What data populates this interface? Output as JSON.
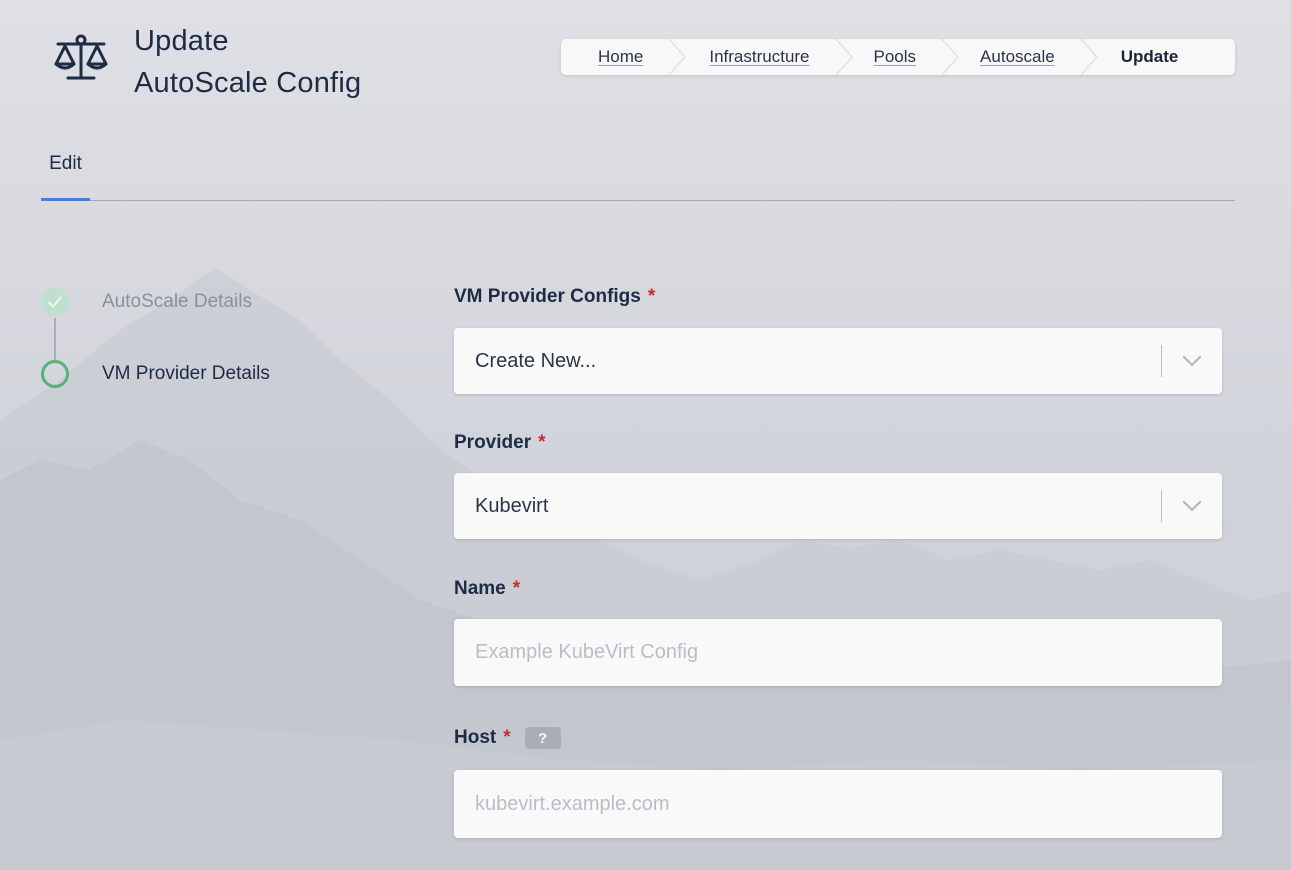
{
  "header": {
    "title_line1": "Update",
    "title_line2": "AutoScale Config",
    "icon": "scale-balance-icon"
  },
  "breadcrumb": [
    {
      "label": "Home"
    },
    {
      "label": "Infrastructure"
    },
    {
      "label": "Pools"
    },
    {
      "label": "Autoscale"
    },
    {
      "label": "Update"
    }
  ],
  "tabs": [
    {
      "label": "Edit",
      "active": true
    }
  ],
  "steps": [
    {
      "label": "AutoScale Details",
      "status": "completed",
      "icon": "check-icon"
    },
    {
      "label": "VM Provider Details",
      "status": "current"
    }
  ],
  "form": {
    "vm_provider_configs": {
      "label": "VM Provider Configs",
      "required_mark": "*",
      "value": "Create New..."
    },
    "provider": {
      "label": "Provider",
      "required_mark": "*",
      "value": "Kubevirt"
    },
    "name": {
      "label": "Name",
      "required_mark": "*",
      "value": "",
      "placeholder": "Example KubeVirt Config"
    },
    "host": {
      "label": "Host",
      "required_mark": "*",
      "help": "?",
      "value": "",
      "placeholder": "kubevirt.example.com"
    }
  },
  "colors": {
    "accent_tab": "#4a7fd6",
    "step_complete": "#bfe0cc",
    "step_current": "#55b27a",
    "required": "#c62b2b"
  }
}
